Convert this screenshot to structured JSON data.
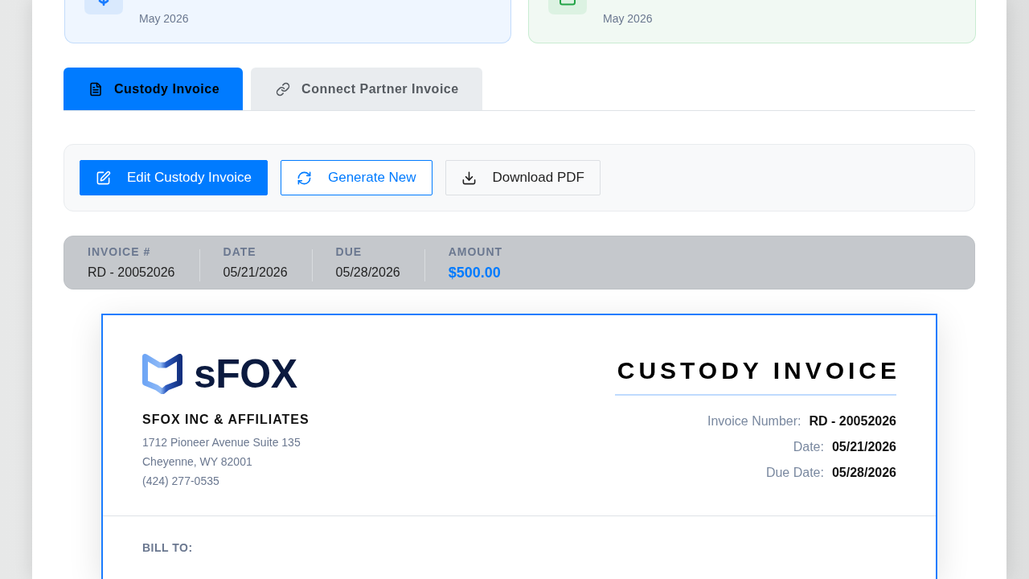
{
  "stat_cards": [
    {
      "kind": "dollar",
      "period": "May 2026"
    },
    {
      "kind": "square",
      "period": "May 2026"
    }
  ],
  "tabs": [
    {
      "label": "Custody Invoice",
      "selected": true
    },
    {
      "label": "Connect Partner Invoice",
      "selected": false
    }
  ],
  "actions": [
    {
      "label": "Edit Custody Invoice",
      "kind": "primary"
    },
    {
      "label": "Generate New",
      "kind": "outline"
    },
    {
      "label": "Download PDF",
      "kind": "plain"
    }
  ],
  "summary": [
    {
      "label": "INVOICE #",
      "value": "RD - 20052026",
      "kind": "text"
    },
    {
      "label": "DATE",
      "value": "05/21/2026",
      "kind": "text"
    },
    {
      "label": "DUE",
      "value": "05/28/2026",
      "kind": "text"
    },
    {
      "label": "AMOUNT",
      "value": "$500.00",
      "kind": "amount"
    }
  ],
  "invoice": {
    "brand": "sFOX",
    "company": "SFOX INC & AFFILIATES",
    "address_lines": [
      "1712 Pioneer Avenue Suite 135",
      "Cheyenne, WY 82001",
      "(424) 277-0535"
    ],
    "title": "CUSTODY INVOICE",
    "details": [
      {
        "label": "Invoice Number:",
        "value": "RD - 20052026"
      },
      {
        "label": "Date:",
        "value": "05/21/2026"
      },
      {
        "label": "Due Date:",
        "value": "05/28/2026"
      }
    ],
    "bill_to_label": "BILL TO:"
  }
}
